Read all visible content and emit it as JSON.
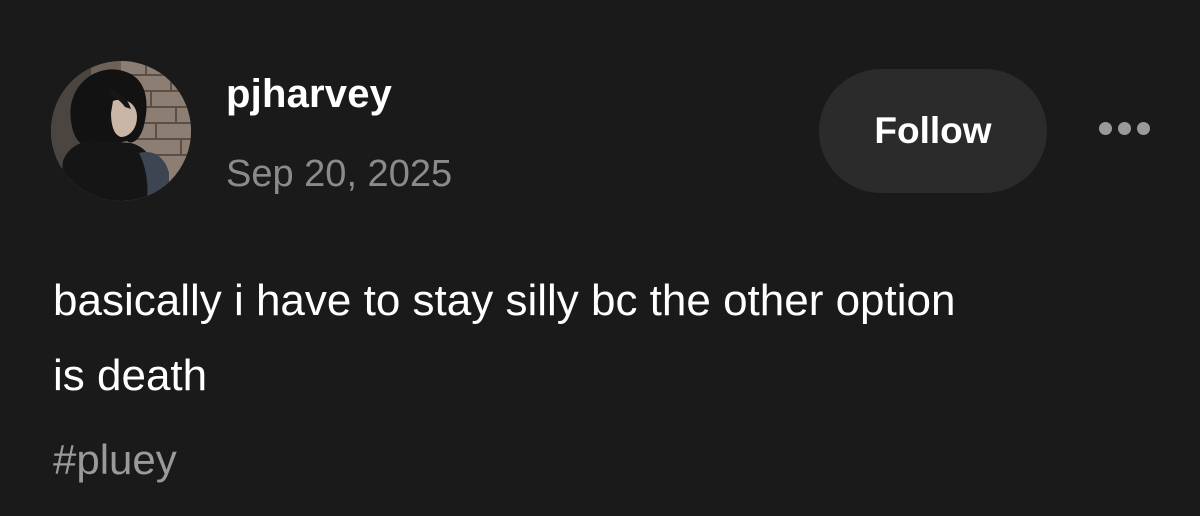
{
  "post": {
    "author": {
      "username": "pjharvey",
      "date": "Sep 20, 2025"
    },
    "follow_label": "Follow",
    "body_lines": [
      "basically i have to stay silly bc the other option",
      "is death"
    ],
    "tags": [
      "#pluey"
    ]
  },
  "colors": {
    "background": "#1a1a1a",
    "text_primary": "#ffffff",
    "text_secondary": "#8b8b8b",
    "button_background": "#2b2b2b"
  },
  "icons": {
    "more": "more-horizontal-icon"
  }
}
